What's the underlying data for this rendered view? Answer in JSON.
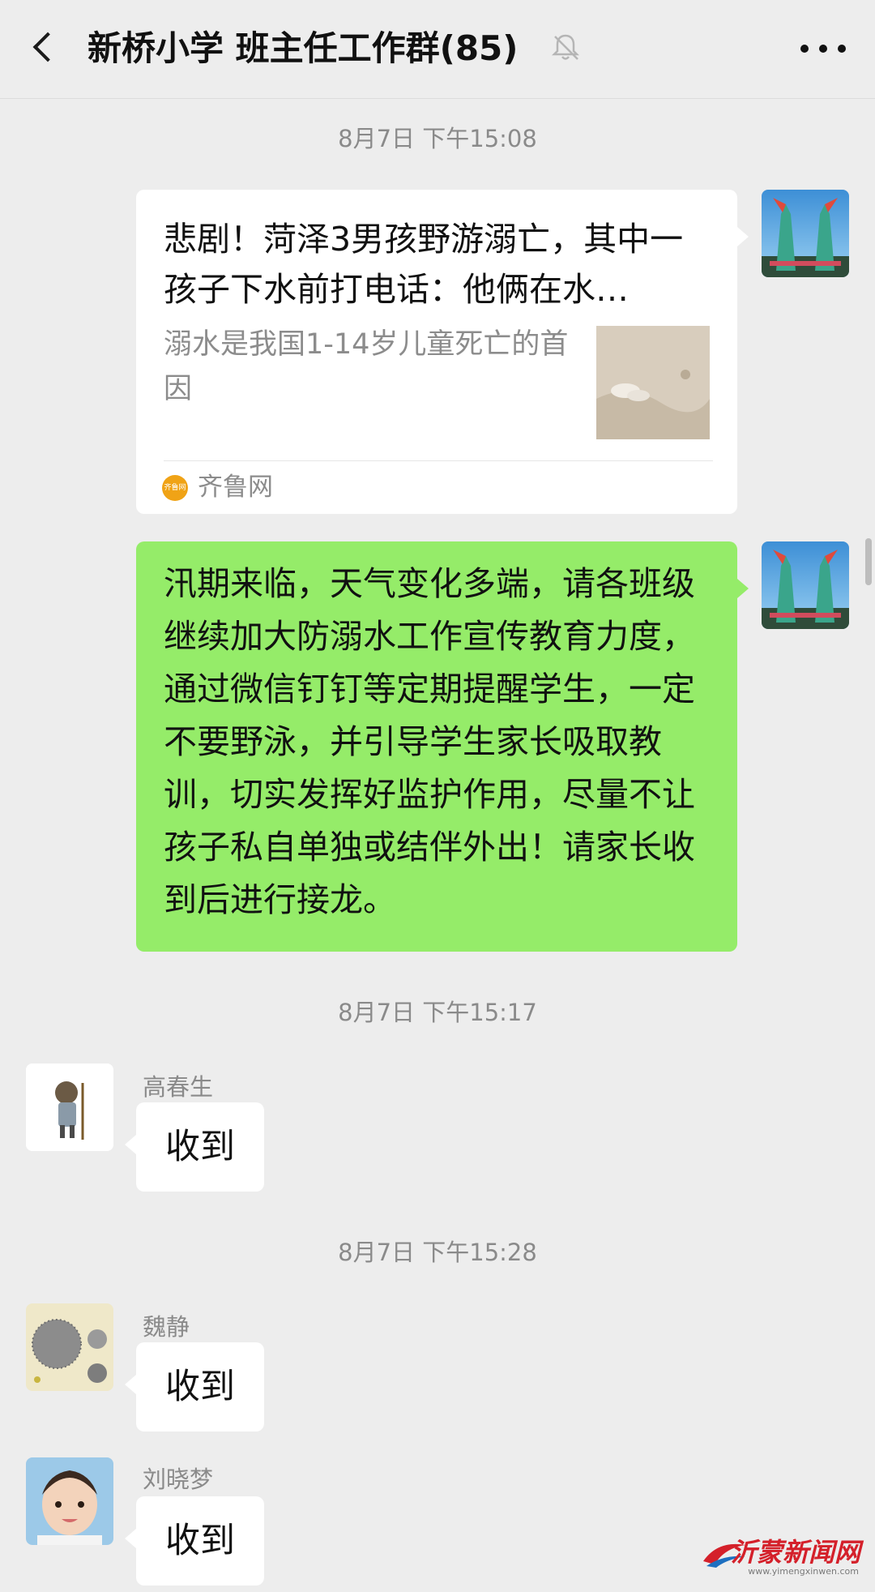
{
  "header": {
    "title": "新桥小学 班主任工作群(85)"
  },
  "messages": {
    "ts1": "8月7日 下午15:08",
    "link_card": {
      "title": "悲剧！菏泽3男孩野游溺亡，其中一孩子下水前打电话：他俩在水…",
      "description": "溺水是我国1-14岁儿童死亡的首因",
      "source_name": "齐鲁网",
      "source_icon_text": "齐鲁网"
    },
    "notice": "汛期来临，天气变化多端，请各班级继续加大防溺水工作宣传教育力度，通过微信钉钉等定期提醒学生，一定不要野泳，并引导学生家长吸取教训，切实发挥好监护作用，尽量不让孩子私自单独或结伴外出！请家长收到后进行接龙。",
    "ts2": "8月7日 下午15:17",
    "reply1": {
      "sender": "高春生",
      "text": "收到"
    },
    "ts3": "8月7日 下午15:28",
    "reply2": {
      "sender": "魏静",
      "text": "收到"
    },
    "reply3": {
      "sender": "刘晓梦",
      "text": "收到"
    }
  },
  "watermark": {
    "text": "沂蒙新闻网",
    "url": "www.yimengxinwen.com"
  },
  "colors": {
    "background": "#ededed",
    "sent_bubble": "#95ec69",
    "received_bubble": "#ffffff",
    "meta_text": "#8a8a8a"
  },
  "icons": [
    "back-arrow-icon",
    "mute-bell-icon",
    "more-dots-icon"
  ]
}
